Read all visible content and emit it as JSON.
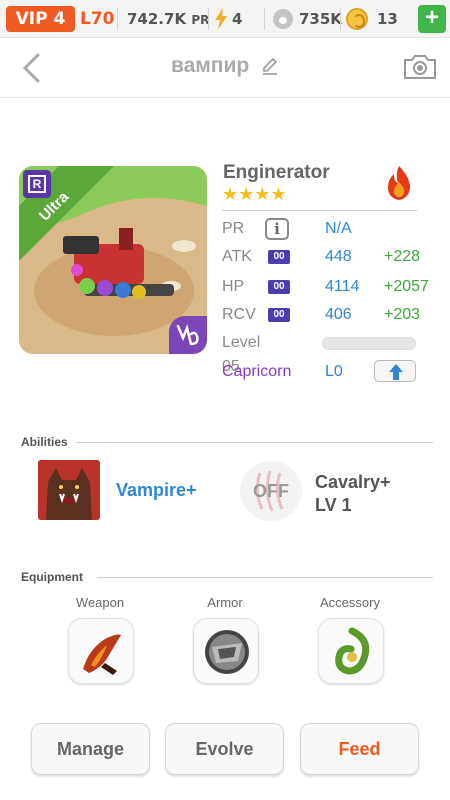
{
  "status_bar": {
    "vip": "VIP 4",
    "level": "L70",
    "pr_value": "742.7K",
    "pr_label": "PR",
    "energy": "4",
    "paw_count": "735K",
    "coins": "13",
    "add_label": "+"
  },
  "header": {
    "title": "вампир"
  },
  "hero": {
    "rarity": "Ultra",
    "rank_badge": "R",
    "name": "Enginerator",
    "stars": "★★★★",
    "stats": [
      {
        "label": "PR",
        "value": "N/A",
        "bonus": ""
      },
      {
        "label": "ATK",
        "badge": "00",
        "value": "448",
        "bonus": "+228"
      },
      {
        "label": "HP",
        "badge": "00",
        "value": "4114",
        "bonus": "+2057"
      },
      {
        "label": "RCV",
        "badge": "00",
        "value": "406",
        "bonus": "+203"
      }
    ],
    "level_label": "Level 05",
    "level_progress": 0.0,
    "zodiac": "Capricorn",
    "zodiac_level": "L0"
  },
  "abilities": {
    "title": "Abilities",
    "primary": "Vampire+",
    "secondary_state": "OFF",
    "secondary_name": "Cavalry+",
    "secondary_level": "LV 1"
  },
  "equipment": {
    "title": "Equipment",
    "slots": [
      "Weapon",
      "Armor",
      "Accessory"
    ]
  },
  "actions": {
    "manage": "Manage",
    "evolve": "Evolve",
    "feed": "Feed"
  },
  "colors": {
    "accent": "#f05a23",
    "blue": "#2f86d4",
    "green": "#3aa83a",
    "purple": "#8a3ac0",
    "badge": "#4a3db0"
  }
}
